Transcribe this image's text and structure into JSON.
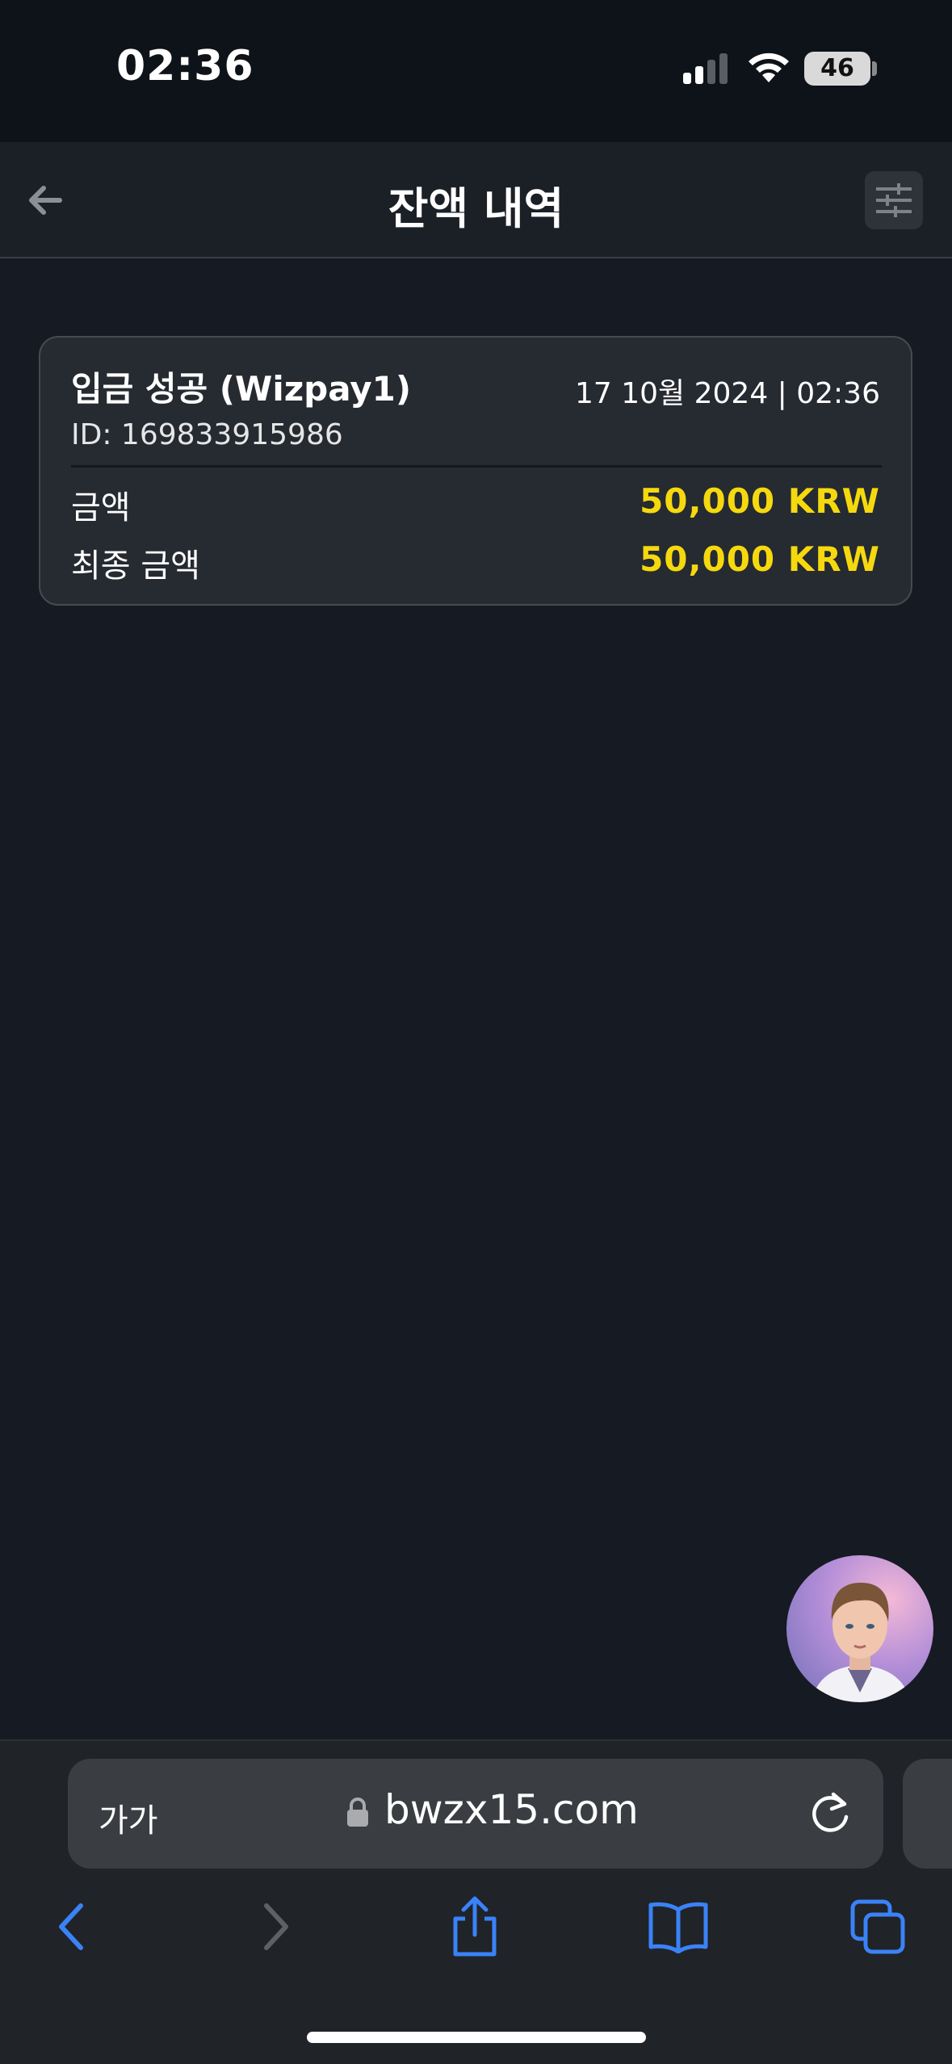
{
  "status_bar": {
    "time": "02:36",
    "battery": "46"
  },
  "header": {
    "title": "잔액 내역"
  },
  "transaction": {
    "title": "입금 성공 (Wizpay1)",
    "datetime": "17 10월 2024 | 02:36",
    "id": "ID: 169833915986",
    "rows": [
      {
        "label": "금액",
        "value": "50,000 KRW"
      },
      {
        "label": "최종 금액",
        "value": "50,000 KRW"
      }
    ]
  },
  "browser": {
    "text_size_label": "가가",
    "url": "bwzx15.com"
  },
  "colors": {
    "accent_amount": "#f5d90e",
    "link_blue": "#3a82f7",
    "background": "#161a22"
  },
  "icons": [
    "back-arrow-icon",
    "filter-sliders-icon",
    "lock-icon",
    "reload-icon",
    "chevron-left-icon",
    "chevron-right-icon",
    "share-icon",
    "bookmarks-icon",
    "tabs-icon"
  ]
}
